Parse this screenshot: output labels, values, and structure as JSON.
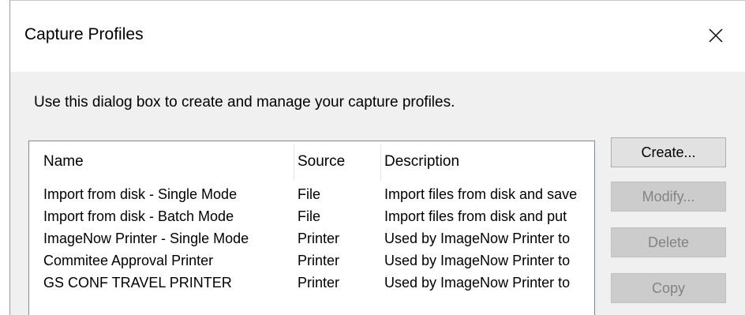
{
  "dialog": {
    "title": "Capture Profiles",
    "close_icon": "close-x-icon"
  },
  "intro_text": "Use this dialog box to create and manage your capture profiles.",
  "list": {
    "columns": [
      "Name",
      "Source",
      "Description"
    ],
    "rows": [
      [
        "Import from disk - Single Mode",
        "File",
        "Import files from disk and save"
      ],
      [
        "Import from disk - Batch Mode",
        "File",
        "Import files from disk and put"
      ],
      [
        "ImageNow Printer - Single Mode",
        "Printer",
        "Used by ImageNow Printer to"
      ],
      [
        "Commitee Approval Printer",
        "Printer",
        "Used by ImageNow Printer to"
      ],
      [
        "GS CONF TRAVEL PRINTER",
        "Printer",
        "Used by ImageNow Printer to"
      ]
    ]
  },
  "buttons": {
    "create": "Create...",
    "modify": "Modify...",
    "delete": "Delete",
    "copy": "Copy"
  },
  "colors": {
    "dialog_background": "#f0f0f0",
    "titlebar_background": "#ffffff",
    "disabled_button_text": "#838383",
    "enabled_button_background": "#e1e1e1"
  }
}
